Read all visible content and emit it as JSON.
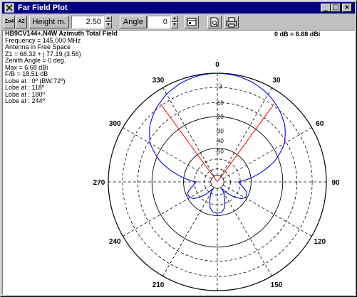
{
  "window": {
    "title": "Far Field Plot"
  },
  "titlebar_buttons": {
    "minimize": "_",
    "maximize": "□",
    "close": "×"
  },
  "toolbar": {
    "zoom_out": "Zo4",
    "zoom_reset": "AZ",
    "height_label": "Height m.",
    "height_value": "2.50",
    "angle_label": "Angle",
    "angle_value": "0",
    "icons": [
      "chart-icon",
      "print-preview-icon",
      "printer-icon"
    ]
  },
  "info": {
    "heading": "HB9CV144+.N4W Azimuth Total Field",
    "lines": [
      "Frequency  =  145.000 MHz",
      "Antenna in Free Space",
      "Z1 = 68.32 + j 77.19 (3.56)",
      "Zenith Angle =  0 deg.",
      "Max = 6.68 dBi",
      "F/B = 18.51 dB",
      "Lobe at : 0º (BW:72º)",
      "Lobe at : 118º",
      "Lobe at : 180º",
      "Lobe at : 244º"
    ],
    "db_reference": "0 dB = 6.68 dBi"
  },
  "chart_data": {
    "type": "polar",
    "angle_labels": [
      "0",
      "30",
      "60",
      "90",
      "120",
      "150",
      "180",
      "210",
      "240",
      "270",
      "300",
      "330"
    ],
    "radial_labels": [
      "-3",
      "-10",
      "-20",
      "-30",
      "-40",
      "-50"
    ],
    "colors": {
      "pattern": "#0000ff",
      "beamwidth": "#ff0000",
      "grid": "#000000"
    },
    "beamwidth_deg": [
      -36,
      36
    ],
    "series": [
      {
        "angles_deg": [
          0,
          10,
          20,
          30,
          40,
          50,
          60,
          70,
          80,
          90,
          100,
          110,
          118,
          125,
          135,
          145,
          155,
          165,
          172,
          180,
          188,
          195,
          205,
          215,
          225,
          235,
          244,
          250,
          260,
          270,
          280,
          290,
          300,
          310,
          320,
          330,
          340,
          350
        ],
        "gain_db": [
          0,
          -0.2,
          -0.8,
          -1.8,
          -3.2,
          -5.0,
          -7.5,
          -11.5,
          -16.5,
          -21,
          -20,
          -18.5,
          -18.3,
          -19,
          -21.5,
          -24,
          -22,
          -19.5,
          -18.7,
          -18.5,
          -18.7,
          -19.5,
          -22,
          -24,
          -21.5,
          -19,
          -18.3,
          -18.5,
          -20,
          -21,
          -16.5,
          -11.5,
          -7.5,
          -5.0,
          -3.2,
          -1.8,
          -0.8,
          -0.2
        ]
      }
    ]
  }
}
